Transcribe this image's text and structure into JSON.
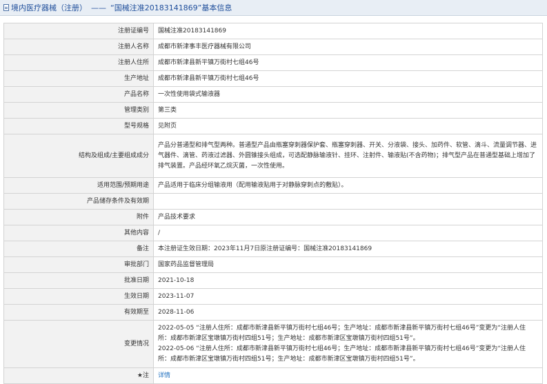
{
  "header": {
    "category": "境内医疗器械（注册）",
    "separator": "——",
    "title": "“国械注准20183141869”基本信息"
  },
  "rows": [
    {
      "label": "注册证编号",
      "value": "国械注准20183141869"
    },
    {
      "label": "注册人名称",
      "value": "成都市新津事丰医疗器械有限公司"
    },
    {
      "label": "注册人住所",
      "value": "成都市新津县新平镇万街村七组46号"
    },
    {
      "label": "生产地址",
      "value": "成都市新津县新平镇万街村七组46号"
    },
    {
      "label": "产品名称",
      "value": "一次性使用袋式输液器"
    },
    {
      "label": "管理类别",
      "value": "第三类"
    },
    {
      "label": "型号规格",
      "value": "见附页"
    },
    {
      "label": "结构及组成/主要组成成分",
      "value": "产品分普通型和排气型两种。普通型产品由瓶塞穿刺器保护套、瓶塞穿刺器、开关、分液袋、接头、加药件、软管、滴斗、流量调节器、进气器件、滴管、药液过滤器、外圆锥接头组成，可选配静脉输液针、挂环、注射件、输液贴(不含药物)；排气型产品在普通型基础上增加了排气装置。产品经环氧乙烷灭菌，一次性使用。"
    },
    {
      "label": "适用范围/预期用途",
      "value": "产品适用于临床分组输液用（配用输液贴用于对静脉穿刺点的敷贴）。"
    },
    {
      "label": "产品储存条件及有效期",
      "value": ""
    },
    {
      "label": "附件",
      "value": "产品技术要求"
    },
    {
      "label": "其他内容",
      "value": "/"
    },
    {
      "label": "备注",
      "value": "本注册证生效日期：2023年11月7日原注册证编号：国械注准20183141869"
    },
    {
      "label": "审批部门",
      "value": "国家药品监督管理局"
    },
    {
      "label": "批准日期",
      "value": "2021-10-18"
    },
    {
      "label": "生效日期",
      "value": "2023-11-07"
    },
    {
      "label": "有效期至",
      "value": "2028-11-06"
    },
    {
      "label": "变更情况",
      "value": "2022-05-05 “注册人住所：成都市新津县新平镇万街村七组46号；生产地址：成都市新津县新平镇万街村七组46号”变更为“注册人住所：成都市新津区宝墩镇万街村四组51号；生产地址：成都市新津区宝墩镇万街村四组51号”。\n2022-05-06 “注册人住所：成都市新津县新平镇万街村七组46号；生产地址：成都市新津县新平镇万街村七组46号”变更为“注册人住所：成都市新津区宝墩镇万街村四组51号；生产地址：成都市新津区宝墩镇万街村四组51号”。"
    }
  ],
  "note": {
    "label": "注",
    "star": "★",
    "link": "详情"
  }
}
